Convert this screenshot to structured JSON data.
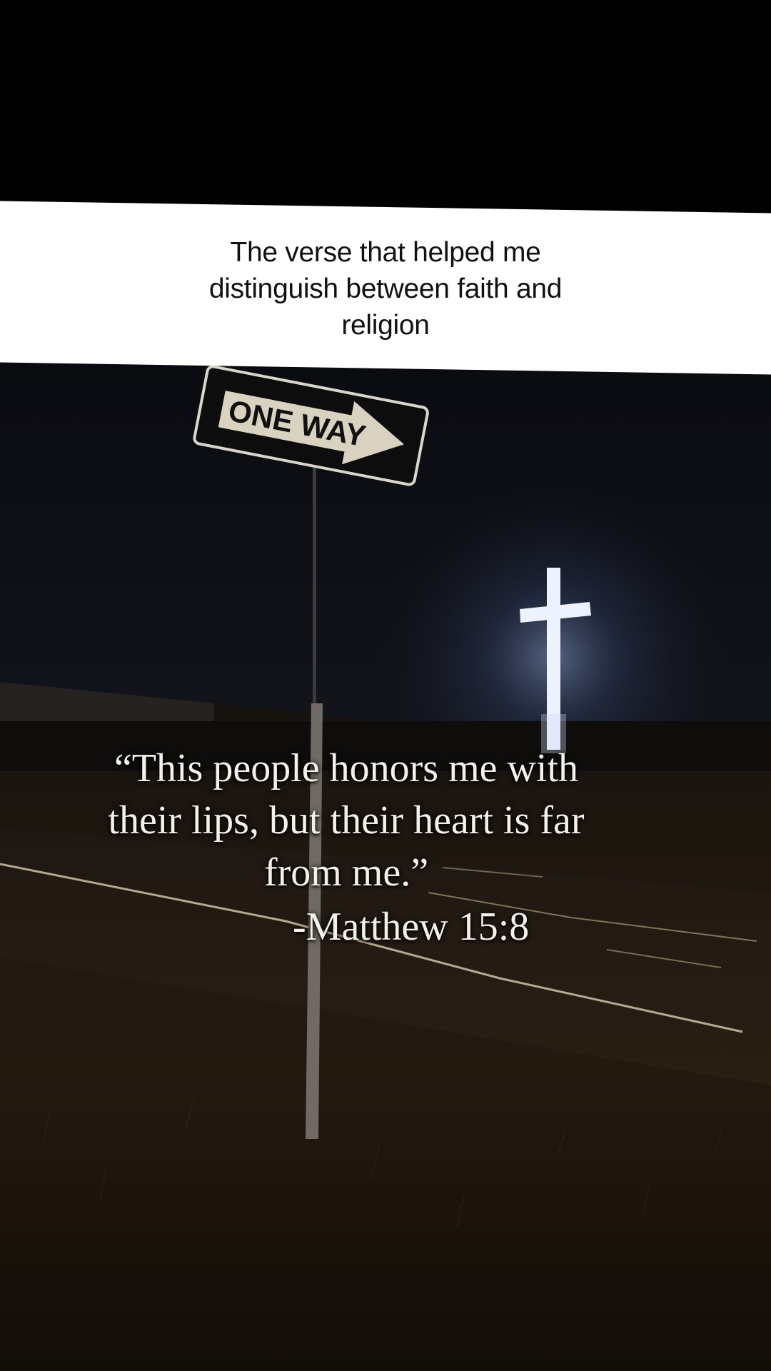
{
  "caption": {
    "lines": [
      "The verse that helped me",
      "distinguish between faith and",
      "religion"
    ]
  },
  "sign": {
    "text": "ONE WAY"
  },
  "verse": {
    "lines": [
      "“This people honors me with",
      "their lips, but their heart is far",
      "from me.”"
    ],
    "reference": "-Matthew 15:8"
  },
  "colors": {
    "top_bar": "#000000",
    "caption_background": "#ffffff",
    "caption_text": "#111111",
    "verse_text": "#f4f1ea",
    "cross_glow": "#dfe8ff"
  }
}
